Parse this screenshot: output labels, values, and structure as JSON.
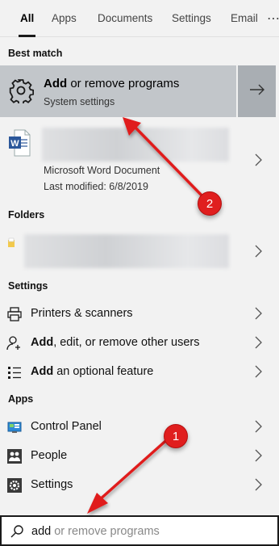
{
  "tabs": [
    {
      "label": "All",
      "active": true
    },
    {
      "label": "Apps"
    },
    {
      "label": "Documents"
    },
    {
      "label": "Settings"
    },
    {
      "label": "Email"
    }
  ],
  "more_tabs_glyph": "⋯",
  "best_match": {
    "section": "Best match",
    "title_bold": "Add",
    "title_rest": " or remove programs",
    "subtitle": "System settings",
    "icon": "gear-icon",
    "action_icon": "arrow-right-icon"
  },
  "document_result": {
    "type_label": "Microsoft Word Document",
    "modified": "Last modified: 6/8/2019",
    "icon": "word-doc-icon"
  },
  "folders": {
    "section": "Folders",
    "icon": "folder-icon"
  },
  "settings": {
    "section": "Settings",
    "items": [
      {
        "bold": "",
        "rest": "Printers & scanners",
        "icon": "printer-icon"
      },
      {
        "bold": "Add",
        "rest": ", edit, or remove other users",
        "icon": "user-add-icon"
      },
      {
        "bold": "Add",
        "rest": " an optional feature",
        "icon": "feature-list-icon"
      }
    ]
  },
  "apps": {
    "section": "Apps",
    "items": [
      {
        "label": "Control Panel",
        "icon": "control-panel-icon"
      },
      {
        "label": "People",
        "icon": "people-icon"
      },
      {
        "label": "Settings",
        "icon": "gear-icon"
      }
    ]
  },
  "search": {
    "typed": "add",
    "suggestion": " or remove programs",
    "icon": "search-icon"
  },
  "annotations": [
    {
      "number": "1"
    },
    {
      "number": "2"
    }
  ],
  "colors": {
    "selected_bg": "#c2c6ca",
    "action_bg": "#a9aeb3",
    "annotation_red": "#e01e1e"
  }
}
